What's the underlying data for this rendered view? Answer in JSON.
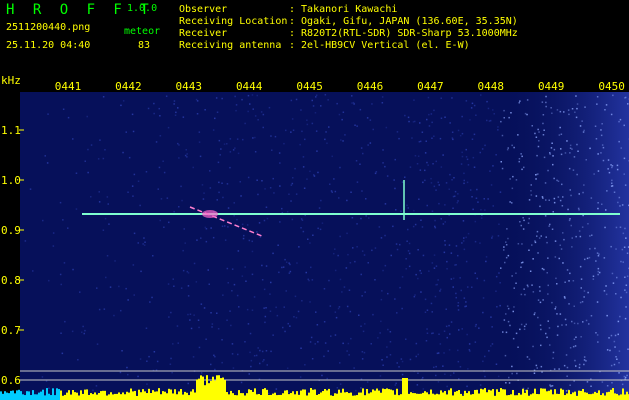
{
  "header": {
    "logo": "H R O F F T",
    "version": "1.0.0",
    "filename": "2511200440.png",
    "timestamp": "25.11.20 04:40",
    "meteor_label": "meteor",
    "meteor_count": "83",
    "info_labels": [
      "Observer",
      "Receiving Location",
      "Receiver",
      "Receiving antenna"
    ],
    "info_values": [
      ": Takanori Kawachi",
      ": Ogaki, Gifu, JAPAN (136.60E, 35.35N)",
      ": R820T2(RTL-SDR) SDR-Sharp 53.1000MHz",
      ": 2el-HB9CV Vertical (el. E-W)"
    ]
  },
  "axis": {
    "unit": "kHz",
    "y_ticks": [
      "1.1",
      "1.0",
      "0.9",
      "0.8",
      "0.7",
      "0.6"
    ],
    "y_values": [
      1.1,
      1.0,
      0.9,
      0.8,
      0.7,
      0.6
    ],
    "x_ticks": [
      "0441",
      "0442",
      "0443",
      "0444",
      "0445",
      "0446",
      "0447",
      "0448",
      "0449",
      "0450"
    ]
  },
  "colors": {
    "background": "#000000",
    "plot_bg": "#06105a",
    "text_green": "#00ff00",
    "text_yellow": "#ffff00",
    "carrier": "#7fffd0",
    "signal": "#ffff00"
  }
}
